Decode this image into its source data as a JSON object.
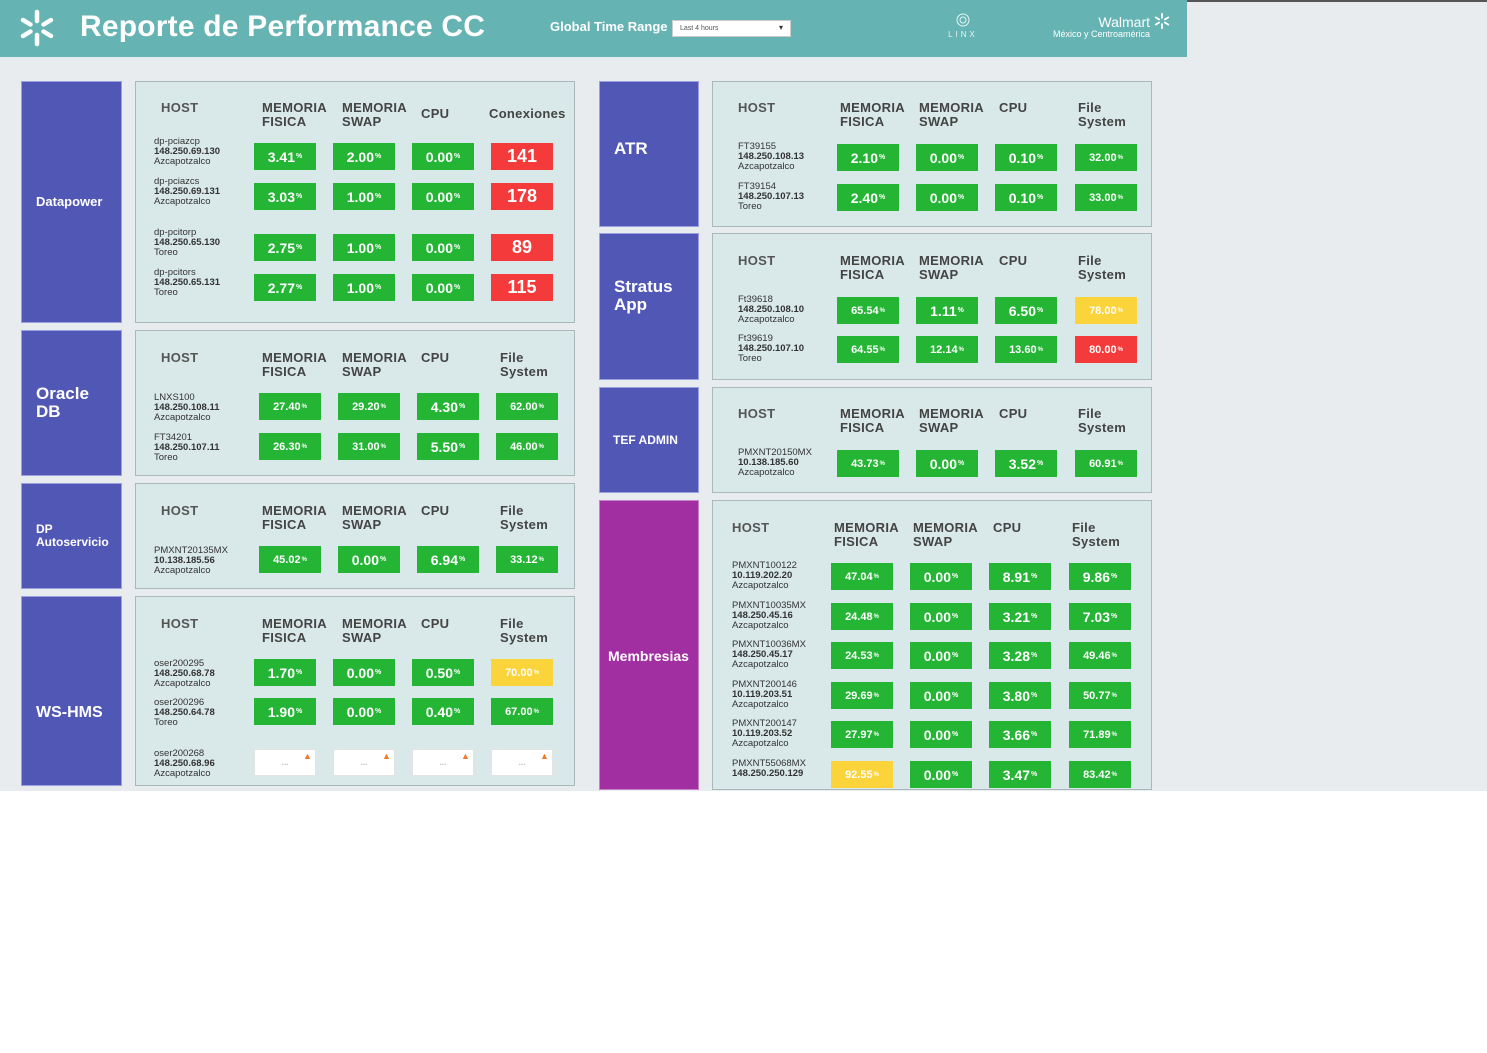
{
  "header": {
    "title": "Reporte de Performance CC",
    "time_range_label": "Global Time Range",
    "time_range_value": "Last 4 hours",
    "linx_logo_text": "LINX",
    "brand_name": "Walmart",
    "brand_sub": "México y Centroamérica"
  },
  "colors": {
    "header": "#66b3b3",
    "label_blue": "#5057b5",
    "label_purple": "#a22fa2",
    "panel": "#d9e8e9",
    "ok": "#25b535",
    "critical": "#f43a3a",
    "warning": "#fbd33a"
  },
  "cols": {
    "host": "HOST",
    "mem_fisica": "MEMORIA\nFISICA",
    "mem_swap": "MEMORIA\nSWAP",
    "cpu": "CPU",
    "filesystem": "File\nSystem",
    "conexiones": "Conexiones"
  },
  "sections": {
    "datapower": {
      "label": "Datapower",
      "rows": [
        {
          "host": "dp-pciazcp",
          "ip": "148.250.69.130",
          "site": "Azcapotzalco",
          "v1": "3.41",
          "v2": "2.00",
          "v3": "0.00",
          "v4": "141",
          "s1": "ok",
          "s2": "ok",
          "s3": "ok",
          "s4": "critical"
        },
        {
          "host": "dp-pciazcs",
          "ip": "148.250.69.131",
          "site": "Azcapotzalco",
          "v1": "3.03",
          "v2": "1.00",
          "v3": "0.00",
          "v4": "178",
          "s1": "ok",
          "s2": "ok",
          "s3": "ok",
          "s4": "critical"
        },
        {
          "host": "dp-pcitorp",
          "ip": "148.250.65.130",
          "site": "Toreo",
          "v1": "2.75",
          "v2": "1.00",
          "v3": "0.00",
          "v4": "89",
          "s1": "ok",
          "s2": "ok",
          "s3": "ok",
          "s4": "critical"
        },
        {
          "host": "dp-pcitors",
          "ip": "148.250.65.131",
          "site": "Toreo",
          "v1": "2.77",
          "v2": "1.00",
          "v3": "0.00",
          "v4": "115",
          "s1": "ok",
          "s2": "ok",
          "s3": "ok",
          "s4": "critical"
        }
      ]
    },
    "oracle": {
      "label": "Oracle\nDB",
      "rows": [
        {
          "host": "LNXS100",
          "ip": "148.250.108.11",
          "site": "Azcapotzalco",
          "v1": "27.40",
          "v2": "29.20",
          "v3": "4.30",
          "v4": "62.00",
          "s1": "ok",
          "s2": "ok",
          "s3": "ok",
          "s4": "ok"
        },
        {
          "host": "FT34201",
          "ip": "148.250.107.11",
          "site": "Toreo",
          "v1": "26.30",
          "v2": "31.00",
          "v3": "5.50",
          "v4": "46.00",
          "s1": "ok",
          "s2": "ok",
          "s3": "ok",
          "s4": "ok"
        }
      ]
    },
    "dpauto": {
      "label": "DP\nAutoservicio",
      "rows": [
        {
          "host": "PMXNT20135MX",
          "ip": "10.138.185.56",
          "site": "Azcapotzalco",
          "v1": "45.02",
          "v2": "0.00",
          "v3": "6.94",
          "v4": "33.12",
          "s1": "ok",
          "s2": "ok",
          "s3": "ok",
          "s4": "ok"
        }
      ]
    },
    "wshms": {
      "label": "WS-HMS",
      "rows": [
        {
          "host": "oser200295",
          "ip": "148.250.68.78",
          "site": "Azcapotzalco",
          "v1": "1.70",
          "v2": "0.00",
          "v3": "0.50",
          "v4": "70.00",
          "s1": "ok",
          "s2": "ok",
          "s3": "ok",
          "s4": "warning"
        },
        {
          "host": "oser200296",
          "ip": "148.250.64.78",
          "site": "Toreo",
          "v1": "1.90",
          "v2": "0.00",
          "v3": "0.40",
          "v4": "67.00",
          "s1": "ok",
          "s2": "ok",
          "s3": "ok",
          "s4": "ok"
        },
        {
          "host": "oser200268",
          "ip": "148.250.68.96",
          "site": "Azcapotzalco",
          "v1": "...",
          "v2": "...",
          "v3": "...",
          "v4": "...",
          "s1": "nodata",
          "s2": "nodata",
          "s3": "nodata",
          "s4": "nodata"
        }
      ]
    },
    "atr": {
      "label": "ATR",
      "rows": [
        {
          "host": "FT39155",
          "ip": "148.250.108.13",
          "site": "Azcapotzalco",
          "v1": "2.10",
          "v2": "0.00",
          "v3": "0.10",
          "v4": "32.00",
          "s1": "ok",
          "s2": "ok",
          "s3": "ok",
          "s4": "ok"
        },
        {
          "host": "FT39154",
          "ip": "148.250.107.13",
          "site": "Toreo",
          "v1": "2.40",
          "v2": "0.00",
          "v3": "0.10",
          "v4": "33.00",
          "s1": "ok",
          "s2": "ok",
          "s3": "ok",
          "s4": "ok"
        }
      ]
    },
    "stratus": {
      "label": "Stratus\nApp",
      "rows": [
        {
          "host": "Ft39618",
          "ip": "148.250.108.10",
          "site": "Azcapotzalco",
          "v1": "65.54",
          "v2": "1.11",
          "v3": "6.50",
          "v4": "78.00",
          "s1": "ok",
          "s2": "ok",
          "s3": "ok",
          "s4": "warning"
        },
        {
          "host": "Ft39619",
          "ip": "148.250.107.10",
          "site": "Toreo",
          "v1": "64.55",
          "v2": "12.14",
          "v3": "13.60",
          "v4": "80.00",
          "s1": "ok",
          "s2": "ok",
          "s3": "ok",
          "s4": "critical"
        }
      ]
    },
    "tef": {
      "label": "TEF ADMIN",
      "rows": [
        {
          "host": "PMXNT20150MX",
          "ip": "10.138.185.60",
          "site": "Azcapotzalco",
          "v1": "43.73",
          "v2": "0.00",
          "v3": "3.52",
          "v4": "60.91",
          "s1": "ok",
          "s2": "ok",
          "s3": "ok",
          "s4": "ok"
        }
      ]
    },
    "membresias": {
      "label": "Membresias",
      "rows": [
        {
          "host": "PMXNT100122",
          "ip": "10.119.202.20",
          "site": "Azcapotzalco",
          "v1": "47.04",
          "v2": "0.00",
          "v3": "8.91",
          "v4": "9.86",
          "s1": "ok",
          "s2": "ok",
          "s3": "ok",
          "s4": "ok"
        },
        {
          "host": "PMXNT10035MX",
          "ip": "148.250.45.16",
          "site": "Azcapotzalco",
          "v1": "24.48",
          "v2": "0.00",
          "v3": "3.21",
          "v4": "7.03",
          "s1": "ok",
          "s2": "ok",
          "s3": "ok",
          "s4": "ok"
        },
        {
          "host": "PMXNT10036MX",
          "ip": "148.250.45.17",
          "site": "Azcapotzalco",
          "v1": "24.53",
          "v2": "0.00",
          "v3": "3.28",
          "v4": "49.46",
          "s1": "ok",
          "s2": "ok",
          "s3": "ok",
          "s4": "ok"
        },
        {
          "host": "PMXNT200146",
          "ip": "10.119.203.51",
          "site": "Azcapotzalco",
          "v1": "29.69",
          "v2": "0.00",
          "v3": "3.80",
          "v4": "50.77",
          "s1": "ok",
          "s2": "ok",
          "s3": "ok",
          "s4": "ok"
        },
        {
          "host": "PMXNT200147",
          "ip": "10.119.203.52",
          "site": "Azcapotzalco",
          "v1": "27.97",
          "v2": "0.00",
          "v3": "3.66",
          "v4": "71.89",
          "s1": "ok",
          "s2": "ok",
          "s3": "ok",
          "s4": "ok"
        },
        {
          "host": "PMXNT55068MX",
          "ip": "148.250.250.129",
          "site": "",
          "v1": "92.55",
          "v2": "0.00",
          "v3": "3.47",
          "v4": "83.42",
          "s1": "warning",
          "s2": "ok",
          "s3": "ok",
          "s4": "ok"
        }
      ]
    }
  }
}
